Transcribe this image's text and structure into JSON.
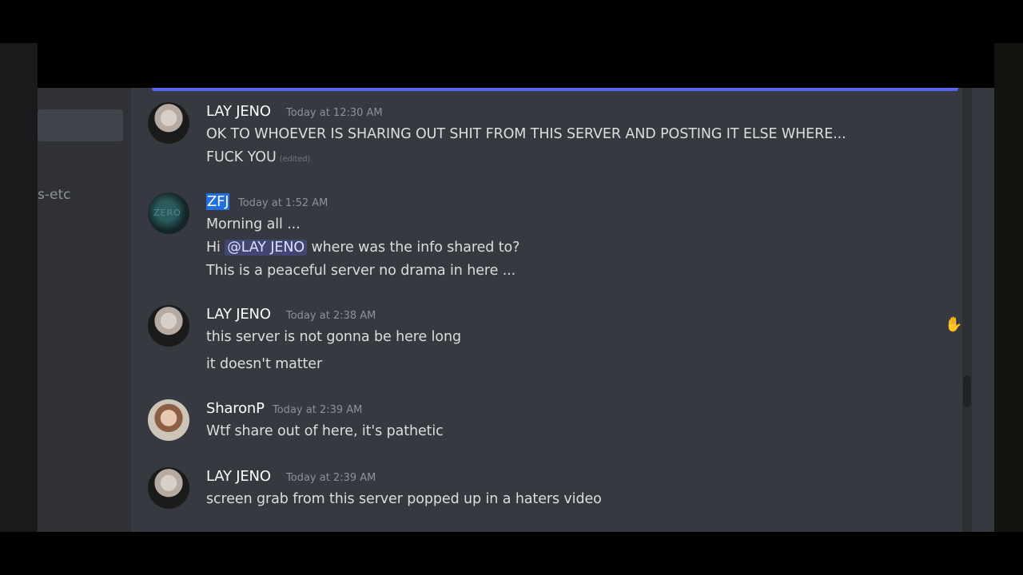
{
  "sidebar": {
    "channel_fragment": "s-etc"
  },
  "messages": [
    {
      "author": "LAY JENO",
      "timestamp": "Today at 12:30 AM",
      "lines": [
        "OK TO WHOEVER IS SHARING OUT SHIT FROM THIS SERVER AND POSTING IT ELSE WHERE...",
        "FUCK YOU"
      ],
      "edited_label": "(edited)"
    },
    {
      "author": "ZFJ",
      "timestamp": "Today at 1:52 AM",
      "avatar_text": "ZERO",
      "lines": [
        "Morning all ...",
        "where was the info shared to?",
        "This is a peaceful server no drama in here ..."
      ],
      "greeting": "Hi",
      "mention": "@LAY JENO"
    },
    {
      "author": "LAY JENO",
      "timestamp": "Today at 2:38 AM",
      "lines": [
        "this server is not gonna be here long",
        "it doesn't matter"
      ]
    },
    {
      "author": "SharonP",
      "timestamp": "Today at 2:39 AM",
      "lines": [
        "Wtf share out of here, it's pathetic"
      ]
    },
    {
      "author": "LAY JENO",
      "timestamp": "Today at 2:39 AM",
      "lines": [
        "screen grab from this server popped up in a haters video"
      ]
    }
  ],
  "cursor_icon": "hand-pointer-icon",
  "colors": {
    "background": "#36393f",
    "accent": "#5865f2",
    "mention_bg": "#414675",
    "username_highlight": "#1f6fe0"
  }
}
